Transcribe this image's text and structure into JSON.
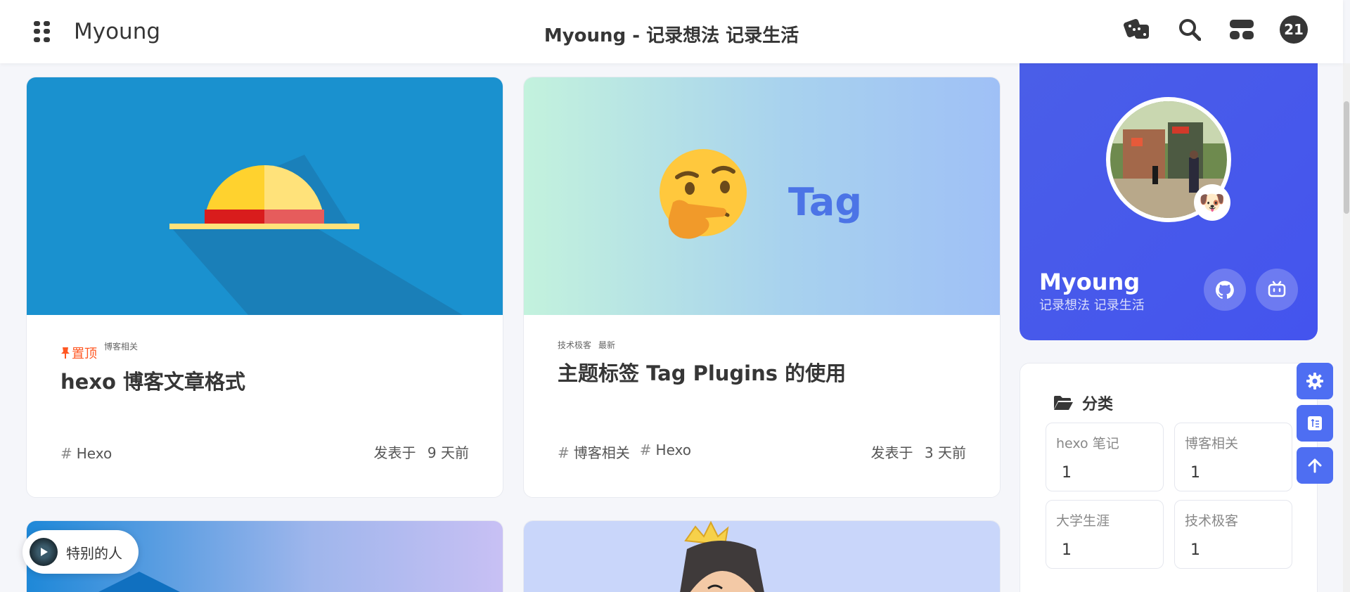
{
  "header": {
    "brand": "Myoung",
    "site_title": "Myoung - 记录想法 记录生活",
    "notification_count": "21",
    "icons": [
      "menu-grid-icon",
      "dice-icon",
      "search-icon",
      "toggle-icon"
    ]
  },
  "posts": [
    {
      "pinned_label": "置顶",
      "category": "博客相关",
      "title": "hexo 博客文章格式",
      "tags": [
        "Hexo"
      ],
      "date_prefix": "发表于",
      "date": "9 天前"
    },
    {
      "category": "技术极客",
      "badge": "最新",
      "title": "主题标签 Tag Plugins 的使用",
      "tags": [
        "博客相关",
        "Hexo"
      ],
      "date_prefix": "发表于",
      "date": "3 天前",
      "cover_text": "Tag"
    }
  ],
  "profile": {
    "name": "Myoung",
    "description": "记录想法 记录生活"
  },
  "categories": {
    "title": "分类",
    "items": [
      {
        "name": "hexo 笔记",
        "count": "1"
      },
      {
        "name": "博客相关",
        "count": "1"
      },
      {
        "name": "大学生涯",
        "count": "1"
      },
      {
        "name": "技术极客",
        "count": "1"
      }
    ]
  },
  "music": {
    "label": "特别的人"
  },
  "colors": {
    "accent": "#4454ee",
    "pinned": "#ff5722",
    "float_button": "#4e6ef2"
  }
}
